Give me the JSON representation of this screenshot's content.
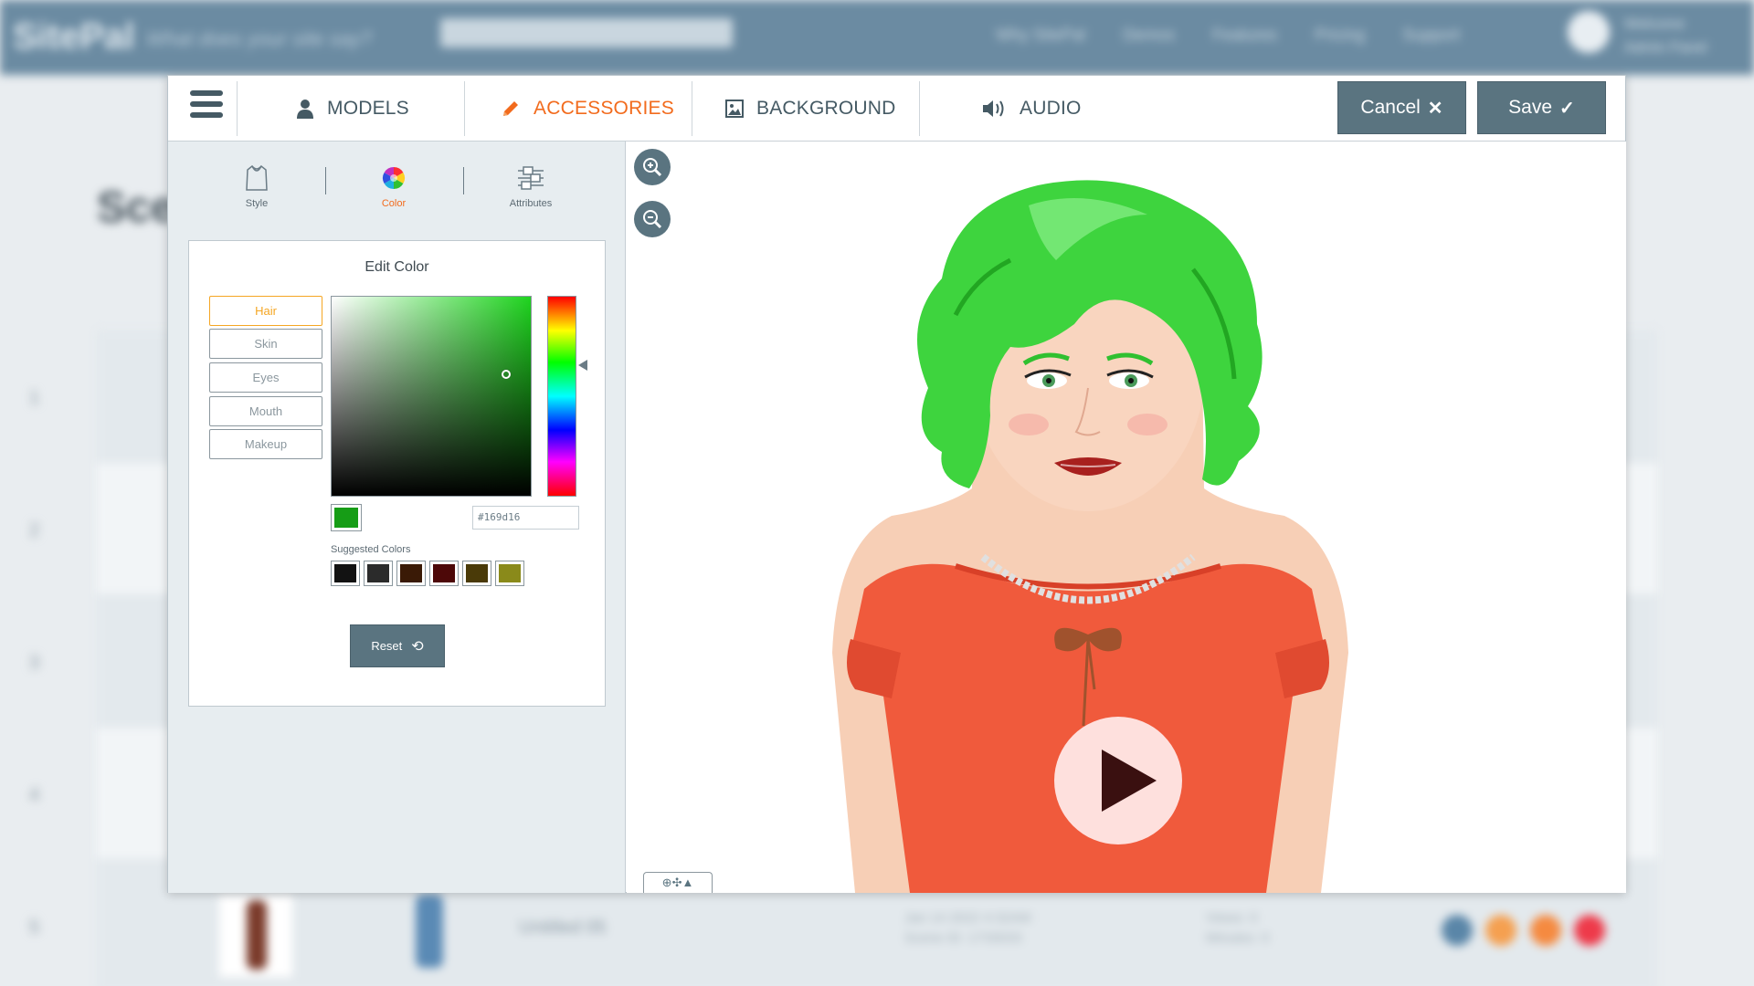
{
  "background": {
    "logo": "SitePal",
    "tagline": "What does your site say?",
    "nav_links": [
      "Why SitePal",
      "Demos",
      "Features",
      "Pricing",
      "Support"
    ],
    "user_line1": "Welcome",
    "user_line2": "Admin Panel",
    "heading": "Sce",
    "row_numbers": [
      "1",
      "2",
      "3",
      "4",
      "5"
    ],
    "untitled": "Untitled 05",
    "meta": [
      "Jan 14 2022 4:32AM",
      "Scene ID: 1733033"
    ],
    "meta2": [
      "Views: 0",
      "Minutes: 0"
    ]
  },
  "tabs": [
    {
      "label": "MODELS",
      "icon": "user-icon"
    },
    {
      "label": "ACCESSORIES",
      "icon": "pencil-icon",
      "active": true
    },
    {
      "label": "BACKGROUND",
      "icon": "image-icon"
    },
    {
      "label": "AUDIO",
      "icon": "speaker-icon"
    }
  ],
  "actions": {
    "cancel_label": "Cancel",
    "cancel_glyph": "✕",
    "save_label": "Save",
    "save_glyph": "✓"
  },
  "subtabs": [
    {
      "label": "Style",
      "icon": "shirt-icon"
    },
    {
      "label": "Color",
      "icon": "color-wheel-icon",
      "active": true
    },
    {
      "label": "Attributes",
      "icon": "sliders-icon"
    }
  ],
  "edit_color": {
    "title": "Edit Color",
    "parts": [
      "Hair",
      "Skin",
      "Eyes",
      "Mouth",
      "Makeup"
    ],
    "active_part": "Hair",
    "hex_value": "#169d16",
    "suggested_label": "Suggested Colors",
    "suggested_colors": [
      "#121212",
      "#2b2b2b",
      "#3a1a06",
      "#4d0808",
      "#4a3a08",
      "#8a8a1a"
    ],
    "reset_label": "Reset",
    "reset_glyph": "⟲"
  },
  "stage": {
    "control_label": "⊕✣▲"
  },
  "colors": {
    "accent": "#f26b1d",
    "button": "#5a7480",
    "hair": "#3ed43e",
    "shirt": "#f05a3c"
  }
}
